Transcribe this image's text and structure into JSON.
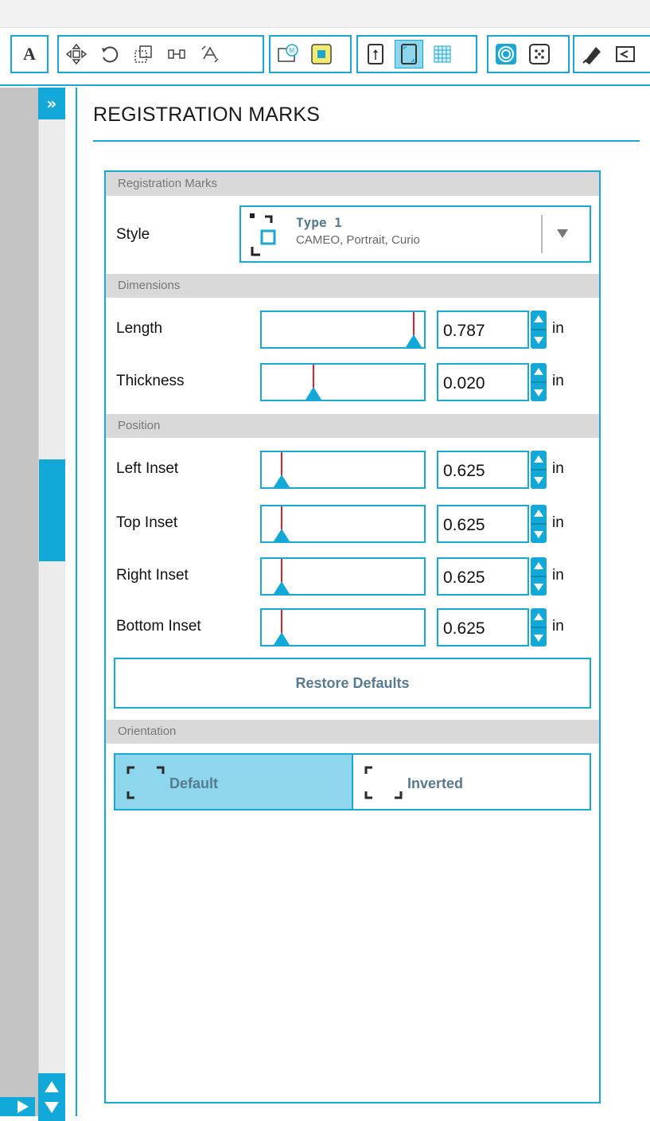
{
  "toolbar": {
    "text_tool_label": "A",
    "groups": [
      {
        "icons": [
          "text-icon"
        ]
      },
      {
        "icons": [
          "move-icon",
          "rotate-icon",
          "scale-icon",
          "align-icon",
          "replicate-icon"
        ]
      },
      {
        "icons": [
          "media-icon",
          "fill-icon"
        ]
      },
      {
        "icons": [
          "page-setup-icon",
          "registration-marks-icon",
          "grid-icon"
        ]
      },
      {
        "icons": [
          "trace-icon",
          "pixscan-icon"
        ]
      },
      {
        "icons": [
          "cut-settings-icon",
          "send-icon"
        ]
      }
    ],
    "active": "registration-marks-icon",
    "accent_color": "#1aa7d4"
  },
  "panel": {
    "title": "REGISTRATION MARKS",
    "sections": {
      "registration": "Registration Marks",
      "dimensions": "Dimensions",
      "position": "Position",
      "orientation": "Orientation"
    },
    "style": {
      "label": "Style",
      "name": "Type 1",
      "subtitle": "CAMEO, Portrait, Curio"
    },
    "dimensions": [
      {
        "label": "Length",
        "value": "0.787",
        "unit": "in",
        "slider_fraction": 1.0
      },
      {
        "label": "Thickness",
        "value": "0.020",
        "unit": "in",
        "slider_fraction": 0.3
      }
    ],
    "position": [
      {
        "label": "Left Inset",
        "value": "0.625",
        "unit": "in",
        "slider_fraction": 0.08
      },
      {
        "label": "Top Inset",
        "value": "0.625",
        "unit": "in",
        "slider_fraction": 0.08
      },
      {
        "label": "Right Inset",
        "value": "0.625",
        "unit": "in",
        "slider_fraction": 0.08
      },
      {
        "label": "Bottom Inset",
        "value": "0.625",
        "unit": "in",
        "slider_fraction": 0.08
      }
    ],
    "restore_label": "Restore Defaults",
    "orientation": {
      "options": [
        "Default",
        "Inverted"
      ],
      "selected": "Default"
    }
  },
  "sidebar": {
    "expand_label": "»"
  }
}
